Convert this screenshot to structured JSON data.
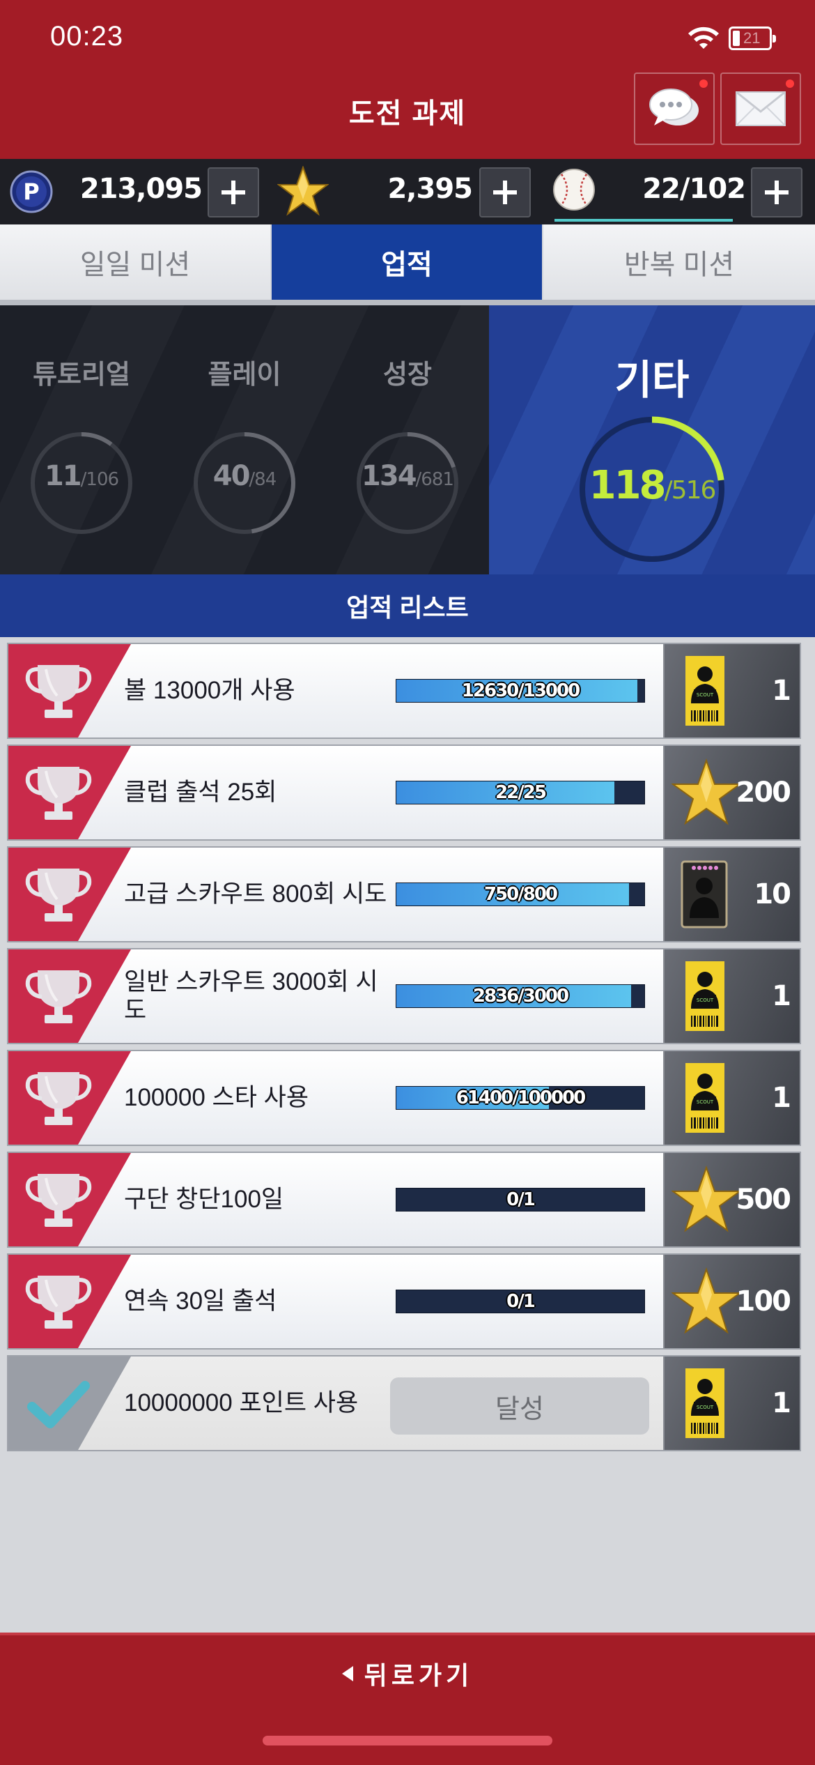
{
  "status": {
    "time": "00:23",
    "battery": "21"
  },
  "header": {
    "title": "도전 과제",
    "chat_icon": "chat-bubbles-icon",
    "mail_icon": "envelope-icon"
  },
  "currencies": {
    "points": {
      "icon": "p-coin-icon",
      "value": "213,095"
    },
    "stars": {
      "icon": "star-icon",
      "value": "2,395"
    },
    "balls": {
      "icon": "baseball-icon",
      "value": "22/102"
    }
  },
  "tabs": [
    {
      "label": "일일 미션",
      "active": false
    },
    {
      "label": "업적",
      "active": true
    },
    {
      "label": "반복 미션",
      "active": false
    }
  ],
  "categories": [
    {
      "title": "튜토리얼",
      "done": "11",
      "total": "/106",
      "progress": 0.104
    },
    {
      "title": "플레이",
      "done": "40",
      "total": "/84",
      "progress": 0.476
    },
    {
      "title": "성장",
      "done": "134",
      "total": "/681",
      "progress": 0.197
    }
  ],
  "active_category": {
    "title": "기타",
    "done": "118",
    "total": "/516",
    "progress": 0.229
  },
  "list_title": "업적 리스트",
  "achievements": [
    {
      "name": "볼 13000개 사용",
      "progress_text": "12630/13000",
      "progress": 0.9715,
      "reward_icon": "scout-ticket-icon",
      "reward_count": "1",
      "completed": false
    },
    {
      "name": "클럽 출석 25회",
      "progress_text": "22/25",
      "progress": 0.88,
      "reward_icon": "star-icon",
      "reward_count": "200",
      "completed": false
    },
    {
      "name": "고급 스카우트 800회 시도",
      "progress_text": "750/800",
      "progress": 0.9375,
      "reward_icon": "player-card-icon",
      "reward_count": "10",
      "completed": false
    },
    {
      "name": "일반 스카우트 3000회 시도",
      "progress_text": "2836/3000",
      "progress": 0.9453,
      "reward_icon": "scout-ticket-icon",
      "reward_count": "1",
      "completed": false
    },
    {
      "name": "100000 스타 사용",
      "progress_text": "61400/100000",
      "progress": 0.614,
      "reward_icon": "scout-ticket-icon",
      "reward_count": "1",
      "completed": false
    },
    {
      "name": "구단 창단100일",
      "progress_text": "0/1",
      "progress": 0,
      "reward_icon": "star-icon",
      "reward_count": "500",
      "completed": false
    },
    {
      "name": "연속 30일 출석",
      "progress_text": "0/1",
      "progress": 0,
      "reward_icon": "star-icon",
      "reward_count": "100",
      "completed": false
    },
    {
      "name": "10000000 포인트 사용",
      "achieved_label": "달성",
      "reward_icon": "scout-ticket-icon",
      "reward_count": "1",
      "completed": true
    }
  ],
  "footer": {
    "back_label": "뒤로가기"
  },
  "colors": {
    "header_red": "#a31c26",
    "active_blue": "#153e9c",
    "accent_green": "#c5ec3c",
    "badge_red": "#c92a4a"
  }
}
